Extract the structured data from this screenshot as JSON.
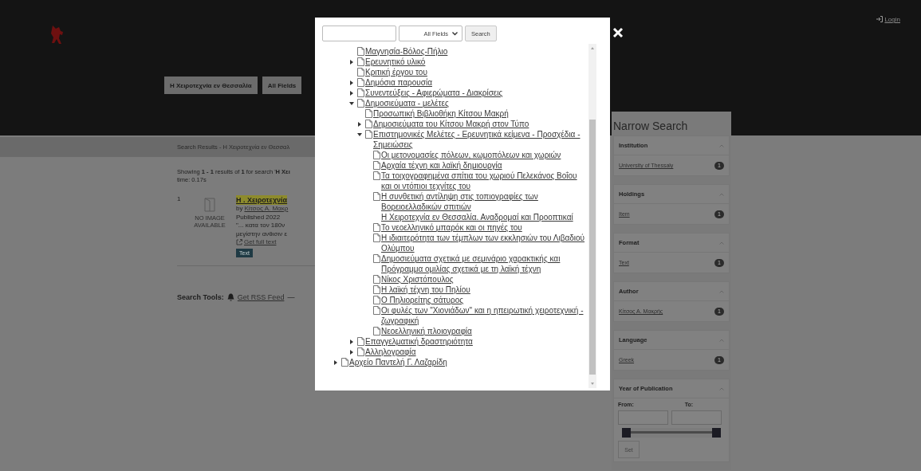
{
  "header": {
    "login": "Login",
    "search_buttons": [
      "Η Χειροτεχνία εν Θεσσαλία",
      "All Fields"
    ]
  },
  "breadcrumb": "Search Results - Η Χειροτεχνία εν Θεσσαλ",
  "results": {
    "summary": "Showing **1 - 1** results of **1** for search '**Η Χει**",
    "time": "time: 0.17s",
    "items": [
      {
        "number": "1",
        "no_image": "NO IMAGE AVAILABLE",
        "title": "Η . Χειροτεχνία",
        "by": "by",
        "author": "Κίτσος Α. Μακρ",
        "published": "Published 2022",
        "snippet_1": "\"... κατα τον 180ν",
        "snippet_2": "μεγίστην ανθισιν ε",
        "full_text": "Get full text",
        "format": "Text"
      }
    ]
  },
  "search_tools": {
    "label": "Search Tools:",
    "rss": "Get RSS Feed",
    "separator": "—"
  },
  "modal": {
    "search": {
      "field": "All Fields",
      "button": "Search"
    },
    "tree_branch": [
      {
        "label": "Μαγνησία-Βόλος-Πήλιο",
        "kind": "document"
      },
      {
        "label": "Ερευνητικό υλικό",
        "kind": "document",
        "expanded": false
      },
      {
        "label": "Κριτική έργου του",
        "kind": "document"
      },
      {
        "label": "Δημόσια παρουσία",
        "kind": "document",
        "expanded": false
      },
      {
        "label": "Συνεντεύξεις - Αφιερώματα - Διακρίσεις",
        "kind": "document",
        "expanded": false
      },
      {
        "label": "Δημοσιεύματα - μελέτες",
        "kind": "document",
        "expanded": true,
        "children": [
          {
            "label": "Προσωπική Βιβλιοθήκη Κίτσου Μακρή",
            "kind": "document"
          },
          {
            "label": "Δημοσιεύματα του Κίτσου Μακρή στον Τύπο",
            "kind": "document",
            "expanded": false
          },
          {
            "label": "Επιστημονικές Μελέτες - Ερευνητικά κείμενα - Προσχέδια - Σημειώσεις",
            "kind": "document",
            "expanded": true,
            "children": [
              {
                "label": "Οι μετονομασίες πόλεων, κωμοπόλεων και χωριών",
                "kind": "document"
              },
              {
                "label": "Αρχαία τέχνη και λαϊκή δημιουργία",
                "kind": "document"
              },
              {
                "label": "Τα τοιχογραφημένα σπίτια του χωριού Πελεκάνος Βοΐου και οι ντόπιοι τεχνίτες του",
                "kind": "document"
              },
              {
                "label": "Η συνθετική αντίληψη στις τοπιογραφίες των Βορειοελλαδικών σπιτιών",
                "kind": "document"
              },
              {
                "label": "Η Χειροτεχνία εν Θεσσαλία. Αναδρομαί και Προοπτικαί",
                "kind": "text"
              },
              {
                "label": "Το νεοελληνικό μπαρόκ και οι πηγές του",
                "kind": "document"
              },
              {
                "label": "Η ιδιαιτερότητα των τέμπλων των εκκλησιών του Λιβαδιού Ολύμπου",
                "kind": "document"
              },
              {
                "label": "Δημοσιεύματα σχετικά με σεμινάριο χαρακτικής και Πρόγραμμα ομιλίας σχετικά με τη λαϊκή τέχνη",
                "kind": "document"
              },
              {
                "label": "Νίκος Χριστόπουλος",
                "kind": "document"
              },
              {
                "label": "Η λαϊκή τέχνη του Πηλίου",
                "kind": "document"
              },
              {
                "label": "Ο Πηλιορείτης σάτυρος",
                "kind": "document"
              },
              {
                "label": "Οι φυλές των \"Χιονιάδων\" και η ηπειρωτική χειροτεχνική - ζωγραφική",
                "kind": "document"
              },
              {
                "label": "Νεοελληνική πλοιογραφία",
                "kind": "document"
              }
            ]
          }
        ]
      },
      {
        "label": "Επαγγελματική δραστηριότητα",
        "kind": "document",
        "expanded": false
      },
      {
        "label": "Αλληλογραφία",
        "kind": "document",
        "expanded": false
      }
    ],
    "tree_root_items": [
      {
        "label": "Αρχείο Παντελή Γ. Λαζαρίδη",
        "kind": "document",
        "expanded": false
      }
    ]
  },
  "sidebar": {
    "title": "Narrow Search",
    "facets": [
      {
        "title": "Institution",
        "item": "University of Thessaly",
        "count": "1"
      },
      {
        "title": "Holdings",
        "item": "Item",
        "count": "1"
      },
      {
        "title": "Format",
        "item": "Text",
        "count": "1"
      },
      {
        "title": "Author",
        "item": "Κίτσος Α. Μακρής",
        "count": "1"
      },
      {
        "title": "Language",
        "item": "Greek",
        "count": "1"
      }
    ],
    "year": {
      "title": "Year of Publication",
      "from": "From:",
      "to": "To:",
      "slider": {
        "level": 1
      },
      "button": "Set"
    }
  }
}
